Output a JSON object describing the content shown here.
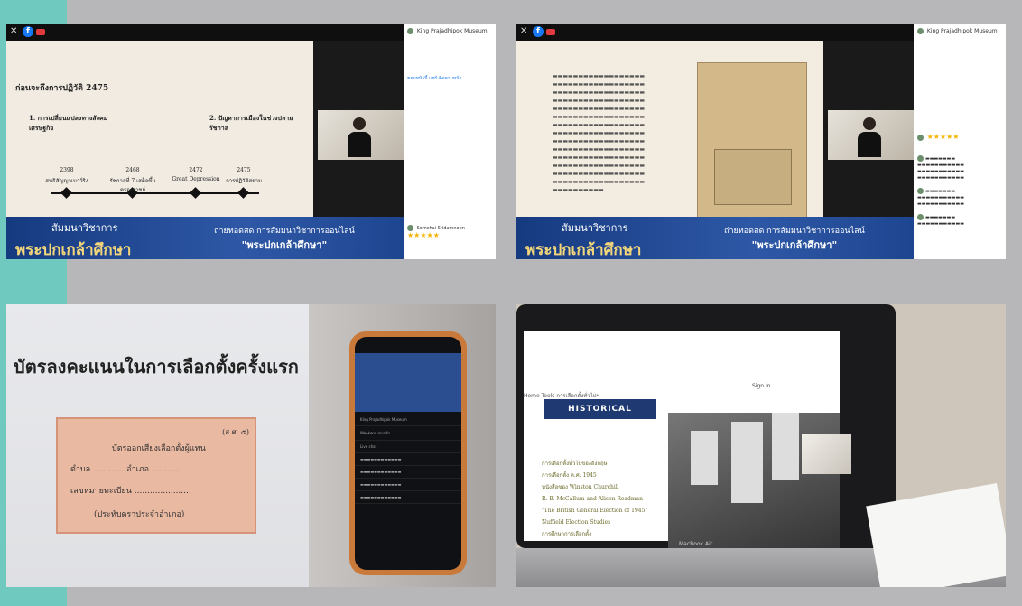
{
  "photo1": {
    "banner_left_top": "สัมมนาวิชาการ",
    "banner_left_brand": "พระปกเกล้าศึกษา",
    "banner_right_1": "ถ่ายทอดสด การสัมมนาวิชาการออนไลน์",
    "banner_right_2": "\"พระปกเกล้าศึกษา\"",
    "slide_title": "ก่อนจะถึงการปฏิวัติ 2475",
    "point1": "1. การเปลี่ยนแปลงทางสังคมเศรษฐกิจ",
    "point2": "2. ปัญหาการเมืองในช่วงปลายรัชกาล",
    "timeline": [
      {
        "year": "2398",
        "label": "สนธิสัญญาเบาว์ริง"
      },
      {
        "year": "2468",
        "label": "รัชกาลที่ 7 เสด็จขึ้นครองราชย์"
      },
      {
        "year": "2472",
        "label": "Great Depression"
      },
      {
        "year": "2475",
        "label": "การปฏิวัติสยาม"
      }
    ],
    "page_name": "King Prajadhipok Museum",
    "sidebar_btns": [
      "ชอบหน้านี้",
      "แชร์",
      "ติดตามหน้า"
    ],
    "comment_author": "Somchai Sridamnoen",
    "stars": "★★★★★"
  },
  "photo2": {
    "banner_left_top": "สัมมนาวิชาการ",
    "banner_left_brand": "พระปกเกล้าศึกษา",
    "banner_right_1": "ถ่ายทอดสด การสัมมนาวิชาการออนไลน์",
    "banner_right_2": "\"พระปกเกล้าศึกษา\"",
    "page_name": "King Prajadhipok Museum",
    "stars": "★★★★★"
  },
  "photo3": {
    "ballot_title": "บัตรลงคะแนนในการเลือกตั้งครั้งแรก",
    "ballot_tag": "(ส.ศ. ๕)",
    "ballot_lines": [
      "บัตรออกเสียงเลือกตั้งผู้แทน",
      "ตำบล ............ อำเภอ ............",
      "เลขหมายทะเบียน ......................",
      "(ประทับตราประจำอำเภอ)"
    ],
    "phone_feed": [
      "King Prajadhipok Museum",
      "Weekend ปกเกล้า",
      "Live chat"
    ]
  },
  "photo4": {
    "sign_in": "Sign In",
    "tabs": "Home   Tools   การเลือกตั้งทั่วไปฯ",
    "heading": "HISTORICAL APPROACH",
    "list": [
      "การเลือกตั้งทั่วไปของอังกฤษ",
      "การเลือกตั้ง ค.ศ. 1945",
      "หนังสือของ Winston Churchill",
      "R. B. McCallum and Alison Readman",
      "\"The British General Election of 1945\"",
      "Nuffield Election Studies",
      "การศึกษาการเลือกตั้ง"
    ],
    "macbook": "MacBook Air"
  }
}
